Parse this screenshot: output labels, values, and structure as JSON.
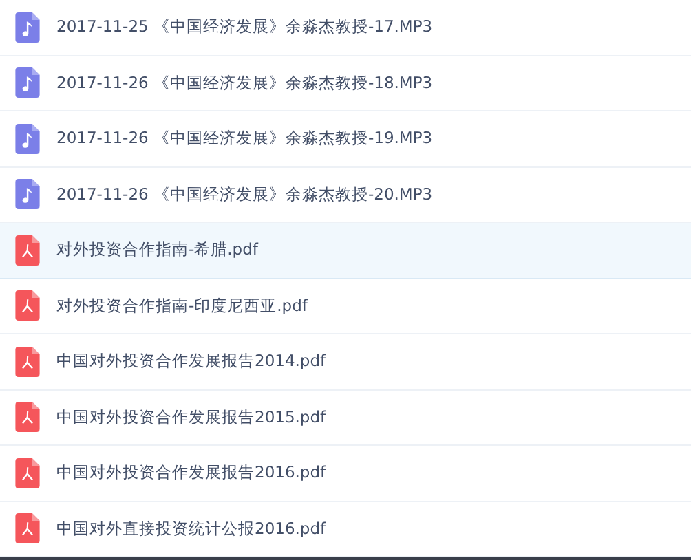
{
  "files": [
    {
      "kind": "audio",
      "name": "2017-11-25 《中国经济发展》余淼杰教授-17.MP3",
      "selected": false
    },
    {
      "kind": "audio",
      "name": "2017-11-26 《中国经济发展》余淼杰教授-18.MP3",
      "selected": false
    },
    {
      "kind": "audio",
      "name": "2017-11-26 《中国经济发展》余淼杰教授-19.MP3",
      "selected": false
    },
    {
      "kind": "audio",
      "name": "2017-11-26 《中国经济发展》余淼杰教授-20.MP3",
      "selected": false
    },
    {
      "kind": "pdf",
      "name": "对外投资合作指南-希腊.pdf",
      "selected": true
    },
    {
      "kind": "pdf",
      "name": "对外投资合作指南-印度尼西亚.pdf",
      "selected": false
    },
    {
      "kind": "pdf",
      "name": "中国对外投资合作发展报告2014.pdf",
      "selected": false
    },
    {
      "kind": "pdf",
      "name": "中国对外投资合作发展报告2015.pdf",
      "selected": false
    },
    {
      "kind": "pdf",
      "name": "中国对外投资合作发展报告2016.pdf",
      "selected": false
    },
    {
      "kind": "pdf",
      "name": "中国对外直接投资统计公报2016.pdf",
      "selected": false
    }
  ]
}
